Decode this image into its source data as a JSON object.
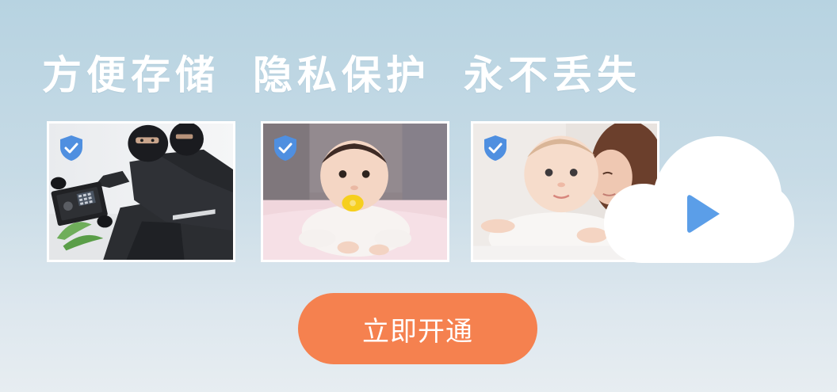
{
  "headline": {
    "parts": [
      "方便存储",
      "隐私保护",
      "永不丢失"
    ]
  },
  "thumbnails": [
    {
      "subject": "burglar-with-safe",
      "badge_icon": "shield-check-icon"
    },
    {
      "subject": "baby-with-pacifier",
      "badge_icon": "shield-check-icon"
    },
    {
      "subject": "mother-and-baby",
      "badge_icon": "shield-check-icon"
    }
  ],
  "cloud": {
    "icon": "cloud-icon",
    "play_icon": "play-icon",
    "play_color": "#5b9ee8"
  },
  "cta": {
    "label": "立即开通",
    "color": "#f5814f"
  },
  "colors": {
    "background_top": "#b7d3e1",
    "background_bottom": "#e7edf1",
    "shield": "#4f8fe0"
  }
}
